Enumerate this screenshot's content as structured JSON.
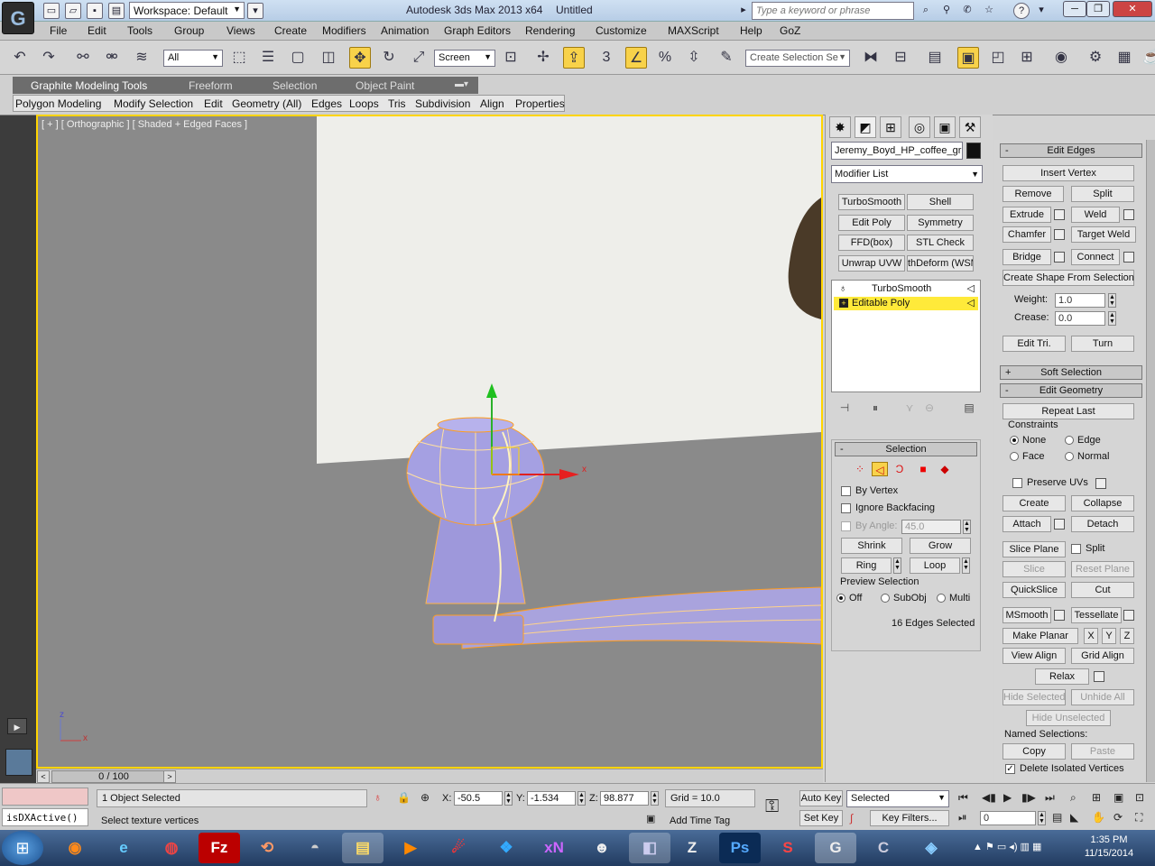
{
  "app": {
    "title": "Autodesk 3ds Max  2013 x64",
    "document": "Untitled",
    "workspace": "Workspace: Default",
    "search_placeholder": "Type a keyword or phrase",
    "logo_letter": "G"
  },
  "menu": [
    "File",
    "Edit",
    "Tools",
    "Group",
    "Views",
    "Create",
    "Modifiers",
    "Animation",
    "Graph Editors",
    "Rendering",
    "Customize",
    "MAXScript",
    "Help",
    "GoZ"
  ],
  "toolbar": {
    "filter": "All",
    "ref_coord": "Screen",
    "named_selection": "Create Selection Se"
  },
  "ribbon": {
    "tabs": [
      "Graphite Modeling Tools",
      "Freeform",
      "Selection",
      "Object Paint"
    ],
    "panels": [
      "Polygon Modeling",
      "Modify Selection",
      "Edit",
      "Geometry (All)",
      "Edges",
      "Loops",
      "Tris",
      "Subdivision",
      "Align",
      "Properties"
    ]
  },
  "viewport": {
    "label_plus": "[ + ]",
    "label_view": "[ Orthographic ]",
    "label_shading": "[ Shaded + Edged Faces ]",
    "axis_z": "z",
    "axis_x": "x",
    "gizmo_x": "x"
  },
  "timeline": {
    "frame": "0 / 100"
  },
  "command_panel": {
    "object_name": "Jeremy_Boyd_HP_coffee_grinder",
    "modifier_list": "Modifier List",
    "modifier_buttons": [
      "TurboSmooth",
      "Shell",
      "Edit Poly",
      "Symmetry",
      "FFD(box)",
      "STL Check",
      "Unwrap UVW",
      "thDeform (WSM)"
    ],
    "stack": [
      "TurboSmooth",
      "Editable Poly"
    ],
    "selection": {
      "title": "Selection",
      "by_vertex": "By Vertex",
      "ignore_backfacing": "Ignore Backfacing",
      "by_angle": "By Angle:",
      "angle_value": "45.0",
      "shrink": "Shrink",
      "grow": "Grow",
      "ring": "Ring",
      "loop": "Loop",
      "preview_title": "Preview Selection",
      "preview_off": "Off",
      "preview_subobj": "SubObj",
      "preview_multi": "Multi",
      "status": "16 Edges Selected"
    }
  },
  "edit_edges": {
    "title": "Edit Edges",
    "insert_vertex": "Insert Vertex",
    "remove": "Remove",
    "split": "Split",
    "extrude": "Extrude",
    "weld": "Weld",
    "chamfer": "Chamfer",
    "target_weld": "Target Weld",
    "bridge": "Bridge",
    "connect": "Connect",
    "create_shape": "Create Shape From Selection",
    "weight_label": "Weight:",
    "weight_value": "1.0",
    "crease_label": "Crease:",
    "crease_value": "0.0",
    "edit_tri": "Edit Tri.",
    "turn": "Turn"
  },
  "soft_selection": {
    "title": "Soft Selection"
  },
  "edit_geometry": {
    "title": "Edit Geometry",
    "repeat_last": "Repeat Last",
    "constraints": "Constraints",
    "none": "None",
    "edge": "Edge",
    "face": "Face",
    "normal": "Normal",
    "preserve_uvs": "Preserve UVs",
    "create": "Create",
    "collapse": "Collapse",
    "attach": "Attach",
    "detach": "Detach",
    "slice_plane": "Slice Plane",
    "split": "Split",
    "slice": "Slice",
    "reset_plane": "Reset Plane",
    "quickslice": "QuickSlice",
    "cut": "Cut",
    "msmooth": "MSmooth",
    "tessellate": "Tessellate",
    "make_planar": "Make Planar",
    "x": "X",
    "y": "Y",
    "z": "Z",
    "view_align": "View Align",
    "grid_align": "Grid Align",
    "relax": "Relax",
    "hide_selected": "Hide Selected",
    "unhide_all": "Unhide All",
    "hide_unselected": "Hide Unselected",
    "named_selections": "Named Selections:",
    "copy": "Copy",
    "paste": "Paste",
    "delete_isolated": "Delete Isolated Vertices"
  },
  "status": {
    "maxscript": "isDXActive()",
    "objects": "1 Object Selected",
    "prompt": "Select texture vertices",
    "x_label": "X:",
    "x": "-50.5",
    "y_label": "Y:",
    "y": "-1.534",
    "z_label": "Z:",
    "z": "98.877",
    "grid": "Grid = 10.0",
    "add_time_tag": "Add Time Tag",
    "auto_key": "Auto Key",
    "set_key": "Set Key",
    "selected": "Selected",
    "key_filters": "Key Filters...",
    "frame_value": "0"
  },
  "taskbar": {
    "time": "1:35 PM",
    "date": "11/15/2014",
    "apps": [
      "firefox-icon",
      "ie-icon",
      "chrome-icon",
      "filezilla-icon",
      "app-icon",
      "app-icon",
      "explorer-icon",
      "media-icon",
      "app-icon",
      "dropbox-icon",
      "xn-icon",
      "app-icon",
      "app-icon",
      "zbrush-icon",
      "photoshop-icon",
      "substance-icon",
      "3dsmax-icon",
      "app-icon",
      "app-icon"
    ],
    "xn_label": "xN",
    "ps_label": "Ps"
  }
}
